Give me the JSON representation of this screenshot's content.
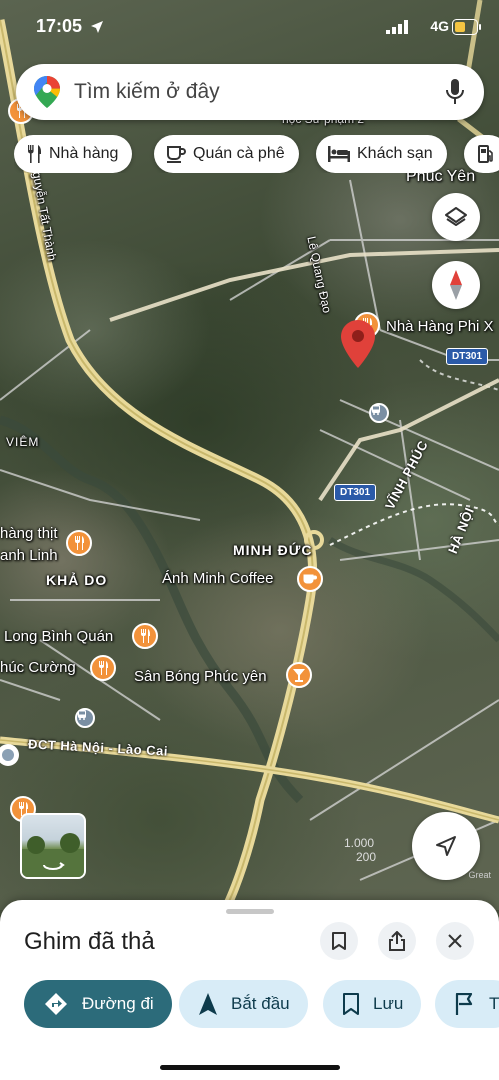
{
  "status_bar": {
    "time": "17:05",
    "network": "4G"
  },
  "search": {
    "placeholder": "Tìm kiếm ở đây",
    "icons": [
      "google-maps-pin-icon",
      "microphone-icon"
    ]
  },
  "chips": [
    {
      "label": "Nhà hàng",
      "icon": "fork-knife-icon"
    },
    {
      "label": "Quán cà phê",
      "icon": "coffee-cup-icon"
    },
    {
      "label": "Khách sạn",
      "icon": "bed-icon"
    },
    {
      "label": "",
      "icon": "gas-pump-icon"
    }
  ],
  "map": {
    "labels": {
      "phuc_yen": "Phúc Yên",
      "le_quang_dao": "Lê Quang Đạo",
      "nha_hang_phi": "Nhà Hàng Phi X",
      "nguyen_tat_thanh": "Nguyễn Tất Thành",
      "hoc_su_pham": "học Sư phạm 2",
      "viem": "VIÊM",
      "hang_thit": "hàng thịt",
      "anh_linh": "anh Linh",
      "kha_do": "KHẢ DO",
      "minh_duc": "MINH ĐỨC",
      "anh_minh_coffee": "Ánh Minh Coffee",
      "long_binh_quan": "Long Bình Quán",
      "phuc_cuong": "húc Cường",
      "san_bong": "Sân Bóng Phúc yên",
      "dct": "ĐCT Hà Nội - Lào Cai",
      "vinh_phuc": "VĨNH PHÚC",
      "ha_noi": "HÀ NỘI"
    },
    "shields": [
      "DT301",
      "DT301"
    ],
    "scale_text_1": "1.000",
    "scale_text_2": "200",
    "attribution": "Great"
  },
  "buttons": {
    "layers": "layers-icon",
    "compass": "compass-icon",
    "my_location": "navigation-arrow-icon",
    "street_view": "street-view-thumbnail"
  },
  "sheet": {
    "title": "Ghim đã thả",
    "icons": [
      "bookmark-icon",
      "share-icon",
      "close-icon"
    ],
    "actions": [
      {
        "label": "Đường đi",
        "icon": "directions-icon",
        "style": "primary"
      },
      {
        "label": "Bắt đầu",
        "icon": "navigation-arrow-icon",
        "style": "secondary"
      },
      {
        "label": "Lưu",
        "icon": "bookmark-icon",
        "style": "secondary"
      },
      {
        "label": "T",
        "icon": "flag-icon",
        "style": "secondary"
      }
    ]
  },
  "colors": {
    "primary_action": "#2c6b7a",
    "secondary_action": "#d8ecf7",
    "poi_orange": "#f2923a",
    "pin_red": "#e0413a",
    "shield_blue": "#2b5aa8"
  }
}
